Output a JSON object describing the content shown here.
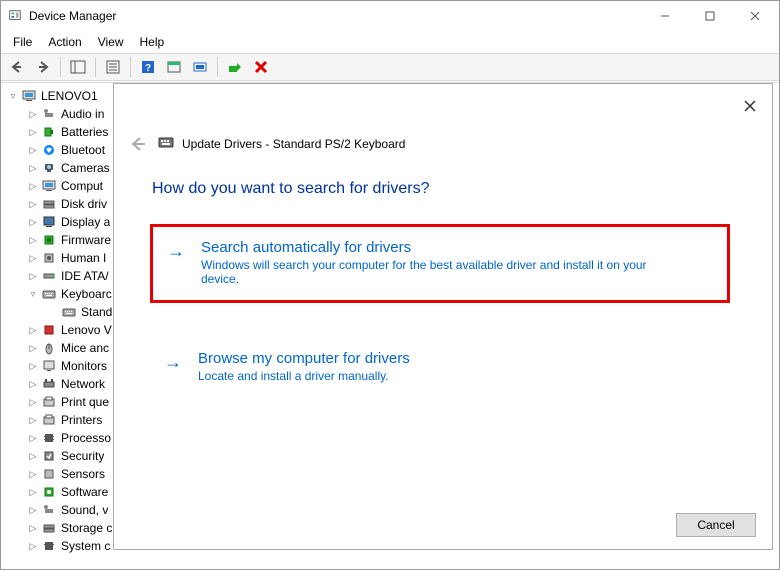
{
  "window": {
    "title": "Device Manager"
  },
  "menubar": {
    "file": "File",
    "action": "Action",
    "view": "View",
    "help": "Help"
  },
  "tree": {
    "root": "LENOVO1",
    "items": [
      {
        "label": "Audio in",
        "expander": "▷"
      },
      {
        "label": "Batteries",
        "expander": "▷"
      },
      {
        "label": "Bluetoot",
        "expander": "▷"
      },
      {
        "label": "Cameras",
        "expander": "▷"
      },
      {
        "label": "Comput",
        "expander": "▷"
      },
      {
        "label": "Disk driv",
        "expander": "▷"
      },
      {
        "label": "Display a",
        "expander": "▷"
      },
      {
        "label": "Firmware",
        "expander": "▷"
      },
      {
        "label": "Human I",
        "expander": "▷"
      },
      {
        "label": "IDE ATA/",
        "expander": "▷"
      },
      {
        "label": "Keyboarc",
        "expander": "▿"
      },
      {
        "label": "Stand",
        "expander": "",
        "child": true
      },
      {
        "label": "Lenovo V",
        "expander": "▷"
      },
      {
        "label": "Mice anc",
        "expander": "▷"
      },
      {
        "label": "Monitors",
        "expander": "▷"
      },
      {
        "label": "Network",
        "expander": "▷"
      },
      {
        "label": "Print que",
        "expander": "▷"
      },
      {
        "label": "Printers",
        "expander": "▷"
      },
      {
        "label": "Processo",
        "expander": "▷"
      },
      {
        "label": "Security",
        "expander": "▷"
      },
      {
        "label": "Sensors",
        "expander": "▷"
      },
      {
        "label": "Software",
        "expander": "▷"
      },
      {
        "label": "Sound, v",
        "expander": "▷"
      },
      {
        "label": "Storage c",
        "expander": "▷"
      },
      {
        "label": "System c",
        "expander": "▷"
      }
    ]
  },
  "dialog": {
    "title": "Update Drivers - Standard PS/2 Keyboard",
    "heading": "How do you want to search for drivers?",
    "option1": {
      "title": "Search automatically for drivers",
      "desc": "Windows will search your computer for the best available driver and install it on your device."
    },
    "option2": {
      "title": "Browse my computer for drivers",
      "desc": "Locate and install a driver manually."
    },
    "cancel": "Cancel"
  }
}
